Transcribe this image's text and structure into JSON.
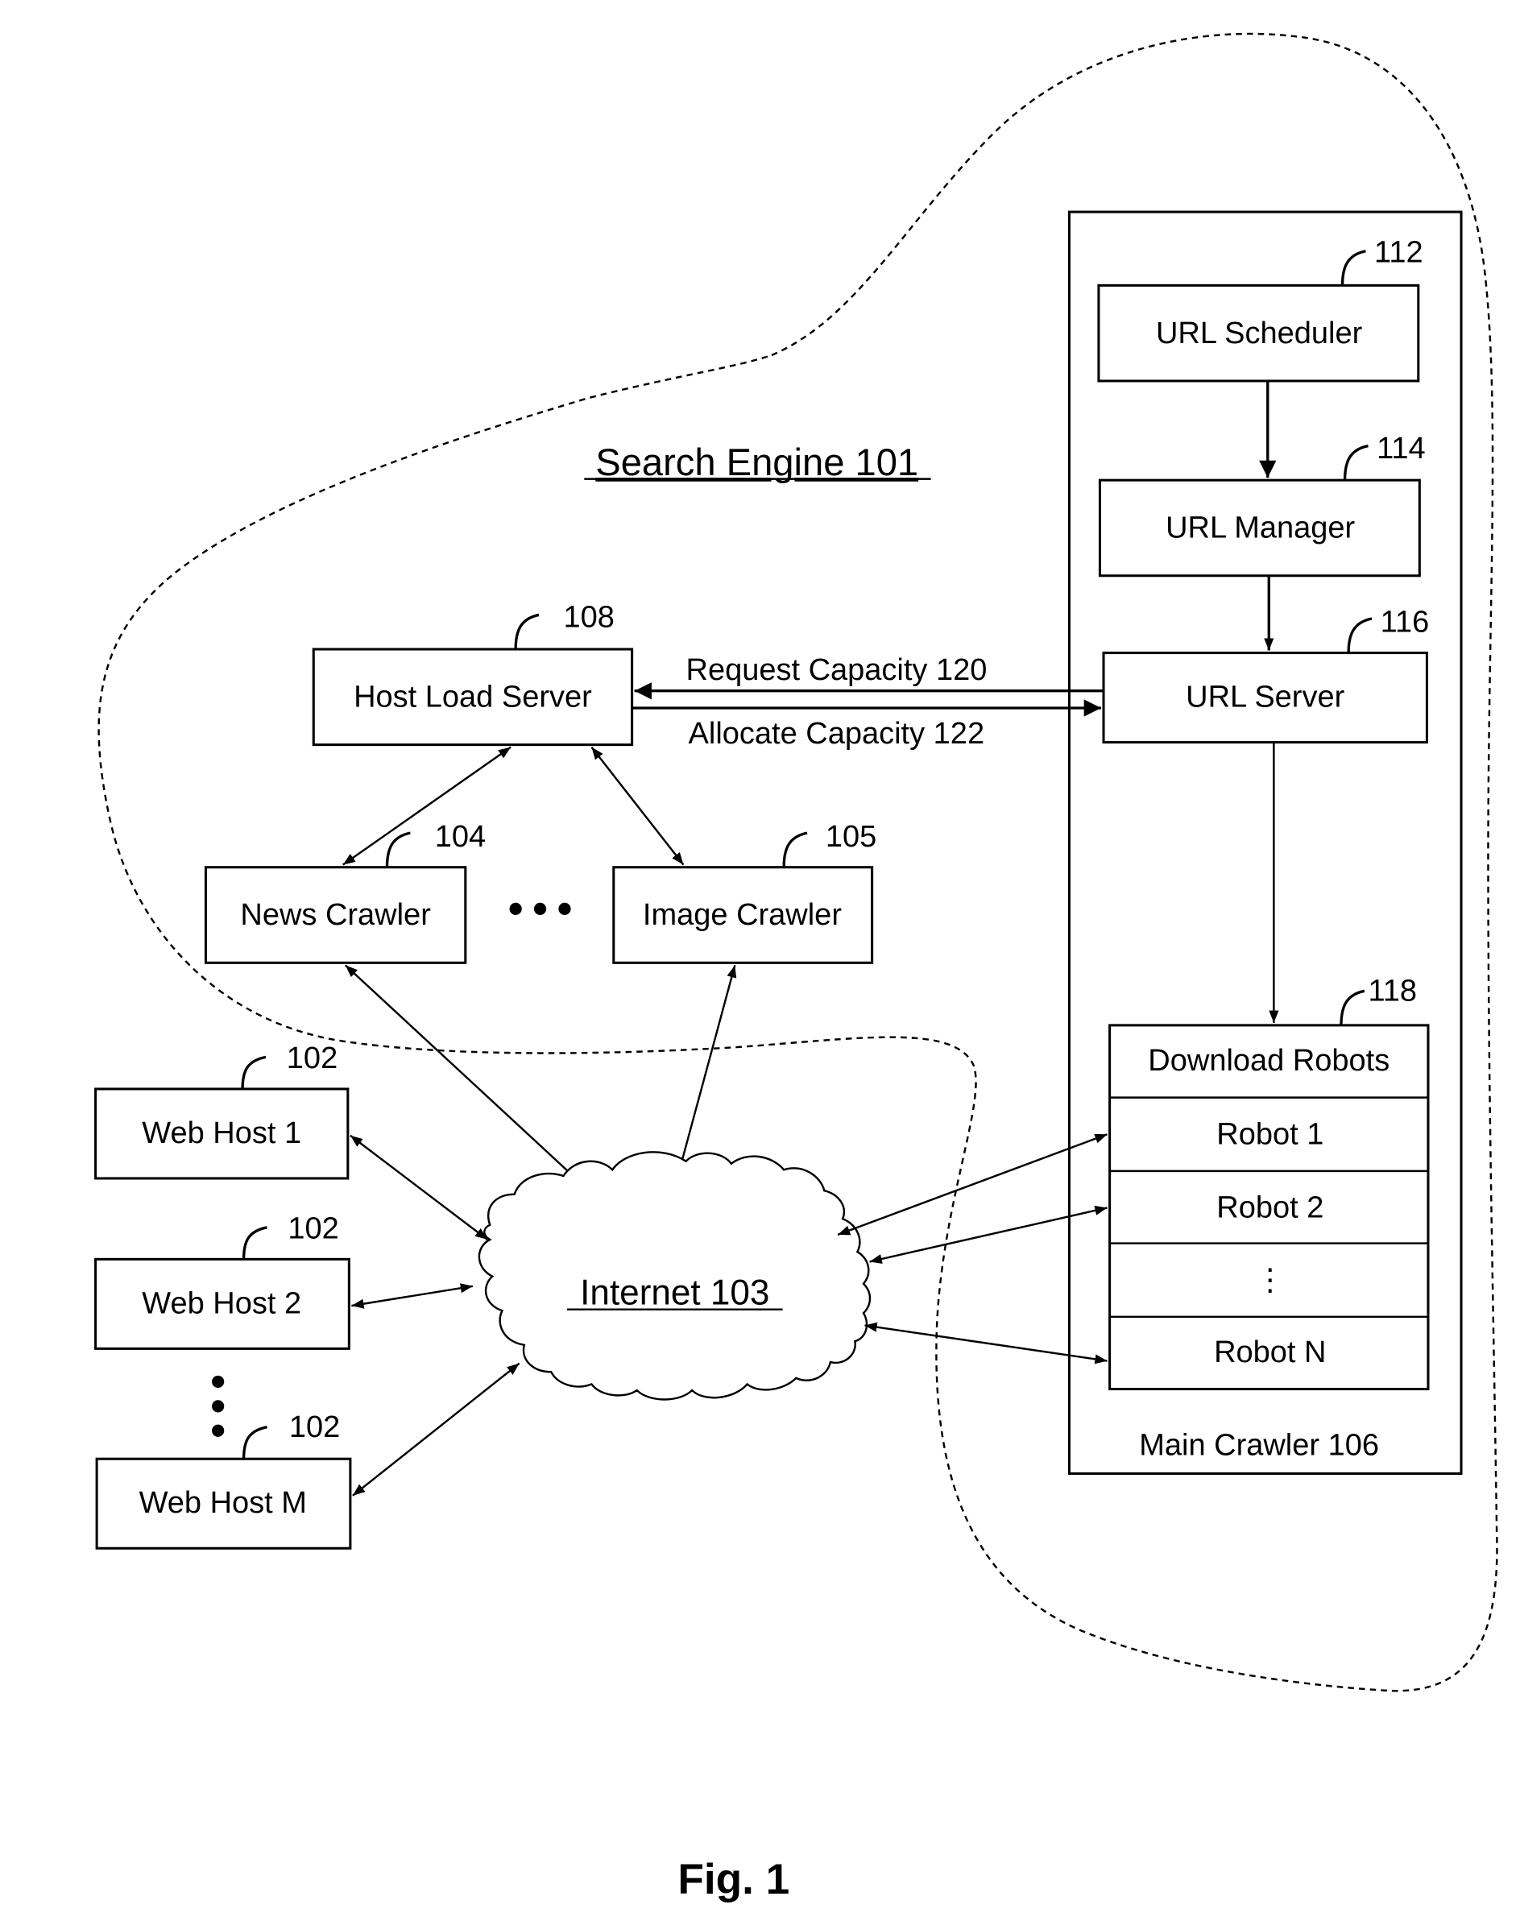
{
  "diagram": {
    "figure_label": "Fig. 1",
    "search_engine": {
      "label": "Search Engine 101"
    },
    "internet": {
      "label": "Internet 103"
    },
    "host_load_server": {
      "label": "Host Load Server",
      "ref": "108"
    },
    "news_crawler": {
      "label": "News Crawler",
      "ref": "104"
    },
    "image_crawler": {
      "label": "Image Crawler",
      "ref": "105"
    },
    "request_capacity": {
      "label": "Request Capacity 120"
    },
    "allocate_capacity": {
      "label": "Allocate Capacity 122"
    },
    "main_crawler": {
      "label": "Main Crawler 106",
      "url_scheduler": {
        "label": "URL Scheduler",
        "ref": "112"
      },
      "url_manager": {
        "label": "URL Manager",
        "ref": "114"
      },
      "url_server": {
        "label": "URL Server",
        "ref": "116"
      },
      "download_robots": {
        "label": "Download Robots",
        "ref": "118",
        "robots": [
          "Robot 1",
          "Robot 2",
          "⋮",
          "Robot N"
        ]
      }
    },
    "web_hosts": [
      {
        "label": "Web Host 1",
        "ref": "102"
      },
      {
        "label": "Web Host 2",
        "ref": "102"
      },
      {
        "label": "Web Host M",
        "ref": "102"
      }
    ]
  }
}
